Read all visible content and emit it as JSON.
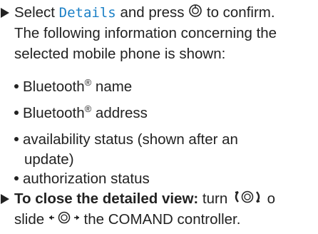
{
  "step1": {
    "line1_pre": "Select ",
    "line1_code": "Details",
    "line1_mid": " and press ",
    "line1_post": " to confirm.",
    "line2": "The following information concerning the",
    "line3": "selected mobile phone is shown:"
  },
  "bullets": [
    {
      "pre": "Bluetooth",
      "sup": "®",
      "post": " name"
    },
    {
      "pre": "Bluetooth",
      "sup": "®",
      "post": " address"
    },
    {
      "line1": "availability status (shown after an",
      "line2": "update)"
    },
    {
      "text": "authorization status"
    }
  ],
  "step2": {
    "bold_label": "To close the detailed view:",
    "turn_text": " turn ",
    "or_text": " o",
    "line2_pre": "slide ",
    "line2_post": " the COMAND controller."
  },
  "icons": {
    "press": "press-controller-icon",
    "turn": "turn-controller-icon",
    "slide": "slide-controller-icon"
  }
}
